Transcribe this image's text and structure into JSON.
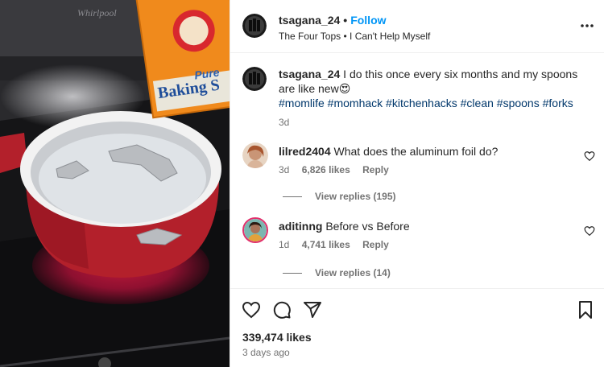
{
  "media": {
    "brand_text": "Whirlpool",
    "box_text_line1": "Pure",
    "box_text_line2": "Baking S"
  },
  "post_header": {
    "username": "tsagana_24",
    "separator": "•",
    "follow_label": "Follow",
    "audio": "The Four Tops • I Can't Help Myself",
    "more_label": "•••"
  },
  "caption": {
    "username": "tsagana_24",
    "text": "I do this once every six months and my spoons are like new",
    "emoji": "😍",
    "hashtags": "#momlife #momhack #kitchenhacks #clean #spoons #forks",
    "time": "3d"
  },
  "comments": [
    {
      "username": "lilred2404",
      "text": "What does the aluminum foil do?",
      "time": "3d",
      "likes": "6,826 likes",
      "reply_label": "Reply",
      "view_replies": "View replies (195)"
    },
    {
      "username": "aditinng",
      "text": "Before vs Before",
      "time": "1d",
      "likes": "4,741 likes",
      "reply_label": "Reply",
      "view_replies": "View replies (14)"
    }
  ],
  "footer": {
    "likes": "339,474 likes",
    "date": "3 days ago"
  },
  "icons": {
    "like": "heart-icon",
    "comment": "comment-icon",
    "share": "share-icon",
    "save": "bookmark-icon",
    "more": "more-icon"
  },
  "colors": {
    "accent": "#0095f6",
    "hashtag": "#00376b",
    "text": "#262626",
    "secondary": "#737373"
  }
}
